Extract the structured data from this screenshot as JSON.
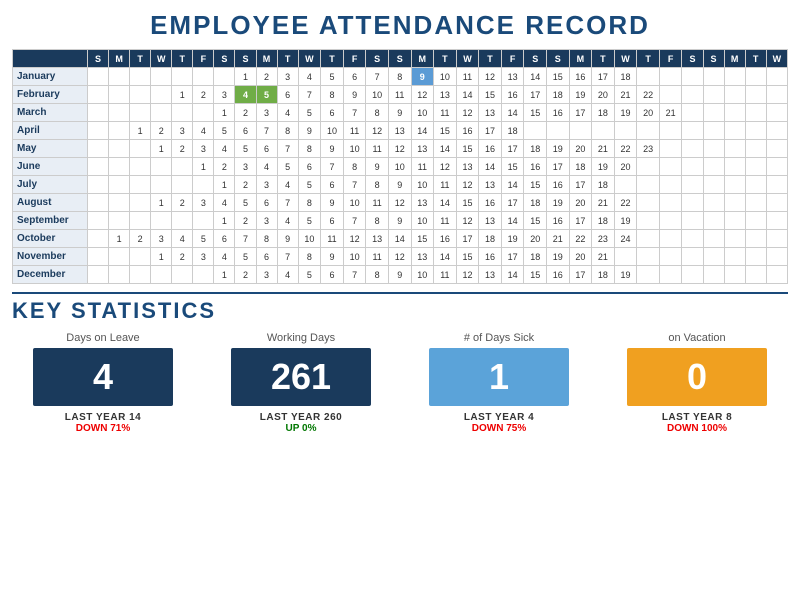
{
  "title": "EMPLOYEE ATTENDANCE RECORD",
  "calendar": {
    "day_headers": [
      "S",
      "M",
      "T",
      "W",
      "T",
      "F",
      "S",
      "S",
      "M",
      "T",
      "W",
      "T",
      "F",
      "S",
      "S",
      "M",
      "T",
      "W",
      "T",
      "F",
      "S",
      "S",
      "M",
      "T",
      "W",
      "T",
      "F",
      "S",
      "S",
      "M",
      "T",
      "W"
    ],
    "months": [
      {
        "name": "January",
        "cells": [
          "",
          "",
          "",
          "",
          "",
          "",
          "",
          "1",
          "2",
          "3",
          "4",
          "5",
          "6",
          "7",
          "8",
          "9",
          "10",
          "11",
          "12",
          "13",
          "14",
          "15",
          "16",
          "17",
          "18",
          "",
          "",
          "",
          "",
          "",
          "",
          ""
        ],
        "highlights": {
          "9": "blue"
        }
      },
      {
        "name": "February",
        "cells": [
          "",
          "",
          "",
          "",
          "1",
          "2",
          "3",
          "4",
          "5",
          "6",
          "7",
          "8",
          "9",
          "10",
          "11",
          "12",
          "13",
          "14",
          "15",
          "16",
          "17",
          "18",
          "19",
          "20",
          "21",
          "22",
          "",
          "",
          "",
          "",
          "",
          ""
        ],
        "highlights": {
          "4": "green",
          "5": "green"
        }
      },
      {
        "name": "March",
        "cells": [
          "",
          "",
          "",
          "",
          "",
          "",
          "1",
          "2",
          "3",
          "4",
          "5",
          "6",
          "7",
          "8",
          "9",
          "10",
          "11",
          "12",
          "13",
          "14",
          "15",
          "16",
          "17",
          "18",
          "19",
          "20",
          "21",
          "",
          "",
          "",
          "",
          ""
        ],
        "highlights": {}
      },
      {
        "name": "April",
        "cells": [
          "",
          "",
          "1",
          "2",
          "3",
          "4",
          "5",
          "6",
          "7",
          "8",
          "9",
          "10",
          "11",
          "12",
          "13",
          "14",
          "15",
          "16",
          "17",
          "18",
          "",
          "",
          "",
          "",
          "",
          "",
          "",
          "",
          "",
          "",
          "",
          ""
        ],
        "highlights": {}
      },
      {
        "name": "May",
        "cells": [
          "",
          "",
          "",
          "1",
          "2",
          "3",
          "4",
          "5",
          "6",
          "7",
          "8",
          "9",
          "10",
          "11",
          "12",
          "13",
          "14",
          "15",
          "16",
          "17",
          "18",
          "19",
          "20",
          "21",
          "22",
          "23",
          "",
          "",
          "",
          "",
          "",
          ""
        ],
        "highlights": {}
      },
      {
        "name": "June",
        "cells": [
          "",
          "",
          "",
          "",
          "",
          "1",
          "2",
          "3",
          "4",
          "5",
          "6",
          "7",
          "8",
          "9",
          "10",
          "11",
          "12",
          "13",
          "14",
          "15",
          "16",
          "17",
          "18",
          "19",
          "20",
          "",
          "",
          "",
          "",
          "",
          "",
          ""
        ],
        "highlights": {}
      },
      {
        "name": "July",
        "cells": [
          "",
          "",
          "",
          "",
          "",
          "",
          "1",
          "2",
          "3",
          "4",
          "5",
          "6",
          "7",
          "8",
          "9",
          "10",
          "11",
          "12",
          "13",
          "14",
          "15",
          "16",
          "17",
          "18",
          "",
          "",
          "",
          "",
          "",
          "",
          "",
          ""
        ],
        "highlights": {}
      },
      {
        "name": "August",
        "cells": [
          "",
          "",
          "",
          "1",
          "2",
          "3",
          "4",
          "5",
          "6",
          "7",
          "8",
          "9",
          "10",
          "11",
          "12",
          "13",
          "14",
          "15",
          "16",
          "17",
          "18",
          "19",
          "20",
          "21",
          "22",
          "",
          "",
          "",
          "",
          "",
          "",
          ""
        ],
        "highlights": {}
      },
      {
        "name": "September",
        "cells": [
          "",
          "",
          "",
          "",
          "",
          "",
          "1",
          "2",
          "3",
          "4",
          "5",
          "6",
          "7",
          "8",
          "9",
          "10",
          "11",
          "12",
          "13",
          "14",
          "15",
          "16",
          "17",
          "18",
          "19",
          "",
          "",
          "",
          "",
          "",
          "",
          ""
        ],
        "highlights": {}
      },
      {
        "name": "October",
        "cells": [
          "",
          "1",
          "2",
          "3",
          "4",
          "5",
          "6",
          "7",
          "8",
          "9",
          "10",
          "11",
          "12",
          "13",
          "14",
          "15",
          "16",
          "17",
          "18",
          "19",
          "20",
          "21",
          "22",
          "23",
          "24",
          "",
          "",
          "",
          "",
          "",
          "",
          ""
        ],
        "highlights": {}
      },
      {
        "name": "November",
        "cells": [
          "",
          "",
          "",
          "1",
          "2",
          "3",
          "4",
          "5",
          "6",
          "7",
          "8",
          "9",
          "10",
          "11",
          "12",
          "13",
          "14",
          "15",
          "16",
          "17",
          "18",
          "19",
          "20",
          "21",
          "",
          "",
          "",
          "",
          "",
          "",
          "",
          ""
        ],
        "highlights": {}
      },
      {
        "name": "December",
        "cells": [
          "",
          "",
          "",
          "",
          "",
          "",
          "1",
          "2",
          "3",
          "4",
          "5",
          "6",
          "7",
          "8",
          "9",
          "10",
          "11",
          "12",
          "13",
          "14",
          "15",
          "16",
          "17",
          "18",
          "19",
          "",
          "",
          "",
          "",
          "",
          "",
          ""
        ],
        "highlights": {}
      }
    ]
  },
  "stats_title": "KEY STATISTICS",
  "stats": [
    {
      "label": "Days on Leave",
      "value": "4",
      "box_color": "dark-blue",
      "last_year_label": "LAST YEAR  14",
      "change_label": "DOWN 71%",
      "change_dir": "down"
    },
    {
      "label": "Working Days",
      "value": "261",
      "box_color": "dark-green",
      "last_year_label": "LAST YEAR  260",
      "change_label": "UP 0%",
      "change_dir": "up"
    },
    {
      "label": "# of Days Sick",
      "value": "1",
      "box_color": "light-blue",
      "last_year_label": "LAST YEAR  4",
      "change_label": "DOWN 75%",
      "change_dir": "down"
    },
    {
      "label": "on Vacation",
      "value": "0",
      "box_color": "orange",
      "last_year_label": "LAST YEAR  8",
      "change_label": "DOWN 100%",
      "change_dir": "down"
    }
  ]
}
